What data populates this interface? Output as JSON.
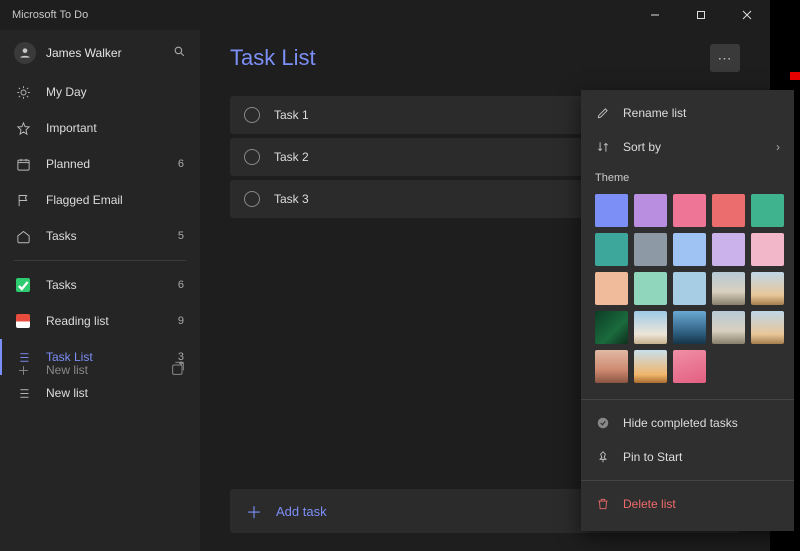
{
  "app": {
    "title": "Microsoft To Do"
  },
  "window_controls": {
    "minimize": "minimize",
    "maximize": "maximize",
    "close": "close"
  },
  "user": {
    "name": "James Walker"
  },
  "sidebar": {
    "items": [
      {
        "icon": "sun",
        "label": "My Day",
        "count": ""
      },
      {
        "icon": "star",
        "label": "Important",
        "count": ""
      },
      {
        "icon": "calendar",
        "label": "Planned",
        "count": "6"
      },
      {
        "icon": "flag",
        "label": "Flagged Email",
        "count": ""
      },
      {
        "icon": "home",
        "label": "Tasks",
        "count": "5"
      }
    ],
    "lists": [
      {
        "color": "#2ecc71",
        "check": true,
        "label": "Tasks",
        "count": "6"
      },
      {
        "color": "#e74c3c",
        "check": false,
        "label": "Reading list",
        "count": "9"
      },
      {
        "color": "#7c8ff7",
        "check": false,
        "label": "Task List",
        "count": "3",
        "active": true
      },
      {
        "color": "",
        "check": false,
        "label": "New list",
        "count": ""
      }
    ],
    "footer": {
      "label": "New list"
    }
  },
  "main": {
    "title": "Task List",
    "more_label": "⋯",
    "tasks": [
      {
        "title": "Task 1"
      },
      {
        "title": "Task 2"
      },
      {
        "title": "Task 3"
      }
    ],
    "add_task_label": "Add task"
  },
  "context_menu": {
    "rename": "Rename list",
    "sort": "Sort by",
    "theme_label": "Theme",
    "swatches": [
      {
        "color": "#7c8ff7",
        "selected": true
      },
      {
        "color": "#b98de0"
      },
      {
        "color": "#ef7596"
      },
      {
        "color": "#ec6d6d"
      },
      {
        "color": "#3fb28e"
      },
      {
        "color": "#3ea79c"
      },
      {
        "color": "#8d9aa6"
      },
      {
        "color": "#9fc4f3"
      },
      {
        "color": "#cbb2ea"
      },
      {
        "color": "#f2b7c8"
      },
      {
        "color": "#f0bb9a"
      },
      {
        "color": "#8fd6bc"
      },
      {
        "color": "#a7cde4"
      },
      {
        "photo": "sw-photo4"
      },
      {
        "photo": "sw-photo5"
      },
      {
        "photo": "sw-photo1"
      },
      {
        "photo": "sw-photo2"
      },
      {
        "photo": "sw-photo3"
      },
      {
        "photo": "sw-photo4"
      },
      {
        "photo": "sw-photo5"
      },
      {
        "photo": "sw-photo6"
      },
      {
        "photo": "sw-photo7"
      },
      {
        "photo": "sw-photo8"
      }
    ],
    "hide_completed": "Hide completed tasks",
    "pin": "Pin to Start",
    "delete": "Delete list"
  }
}
